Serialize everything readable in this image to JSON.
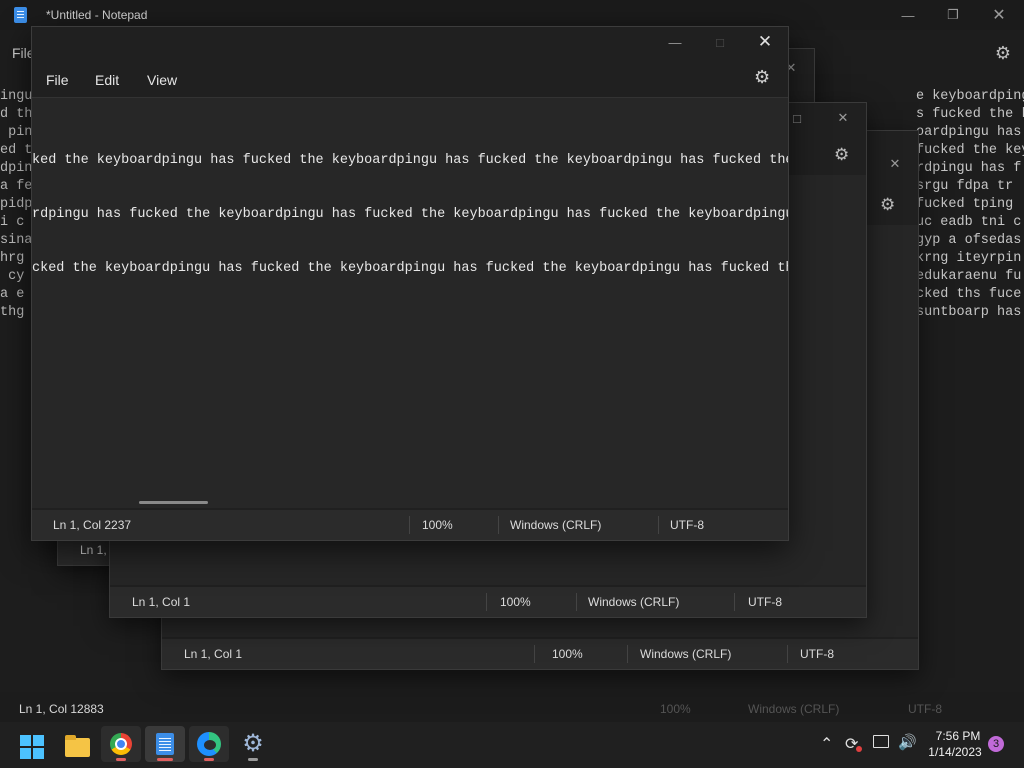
{
  "background_window": {
    "title": "*Untitled - Notepad",
    "menu_file": "File",
    "text_left": [
      "ingu",
      "d th",
      " pin",
      "ed t",
      "dpin",
      "a fe",
      "pidp",
      "i c",
      "sina",
      "hrg",
      " cy",
      "a e",
      "thg"
    ],
    "text_right": [
      "e keyboardpingu has fuc",
      "s fucked the keyboa",
      "oardpingu has fu",
      "fucked the keybo",
      "rdpingu has f",
      "srgu fdpa tr",
      "fucked tping",
      "uc eadb tni c",
      "gyp a ofsedas",
      "krng iteyrpin",
      "edukaraenu fu",
      "cked ths fuce",
      "suntboarp has"
    ],
    "status": {
      "position": "Ln 1, Col 12883",
      "zoom": "100%",
      "line_ending": "Windows (CRLF)",
      "encoding": "UTF-8"
    }
  },
  "window_a": {
    "status": {
      "position": "Ln 1, C"
    }
  },
  "window_b": {
    "status": {
      "position": "Ln 1, Col 1",
      "zoom": "100%",
      "line_ending": "Windows (CRLF)",
      "encoding": "UTF-8"
    }
  },
  "window_c": {
    "status": {
      "position": "Ln 1, Col 1",
      "zoom": "100%",
      "line_ending": "Windows (CRLF)",
      "encoding": "UTF-8"
    }
  },
  "front_window": {
    "menu": {
      "file": "File",
      "edit": "Edit",
      "view": "View"
    },
    "lines": [
      "ked the keyboardpingu has fucked the keyboardpingu has fucked the keyboardpingu has fucked the",
      "rdpingu has fucked the keyboardpingu has fucked the keyboardpingu has fucked the keyboardpingu",
      "cked the keyboardpingu has fucked the keyboardpingu has fucked the keyboardpingu has fucked the"
    ],
    "status": {
      "position": "Ln 1, Col 2237",
      "zoom": "100%",
      "line_ending": "Windows (CRLF)",
      "encoding": "UTF-8"
    }
  },
  "taskbar": {
    "apps": [
      "start-icon",
      "file-explorer-icon",
      "chrome-icon",
      "notepad-icon",
      "edge-icon",
      "settings-icon"
    ],
    "clock_time": "7:56 PM",
    "clock_date": "1/14/2023",
    "notification_count": "3"
  },
  "colors": {
    "accent": "#3c8ee8",
    "window_bg": "#202020",
    "editor_bg": "#272727",
    "badge": "#c16ad8"
  }
}
